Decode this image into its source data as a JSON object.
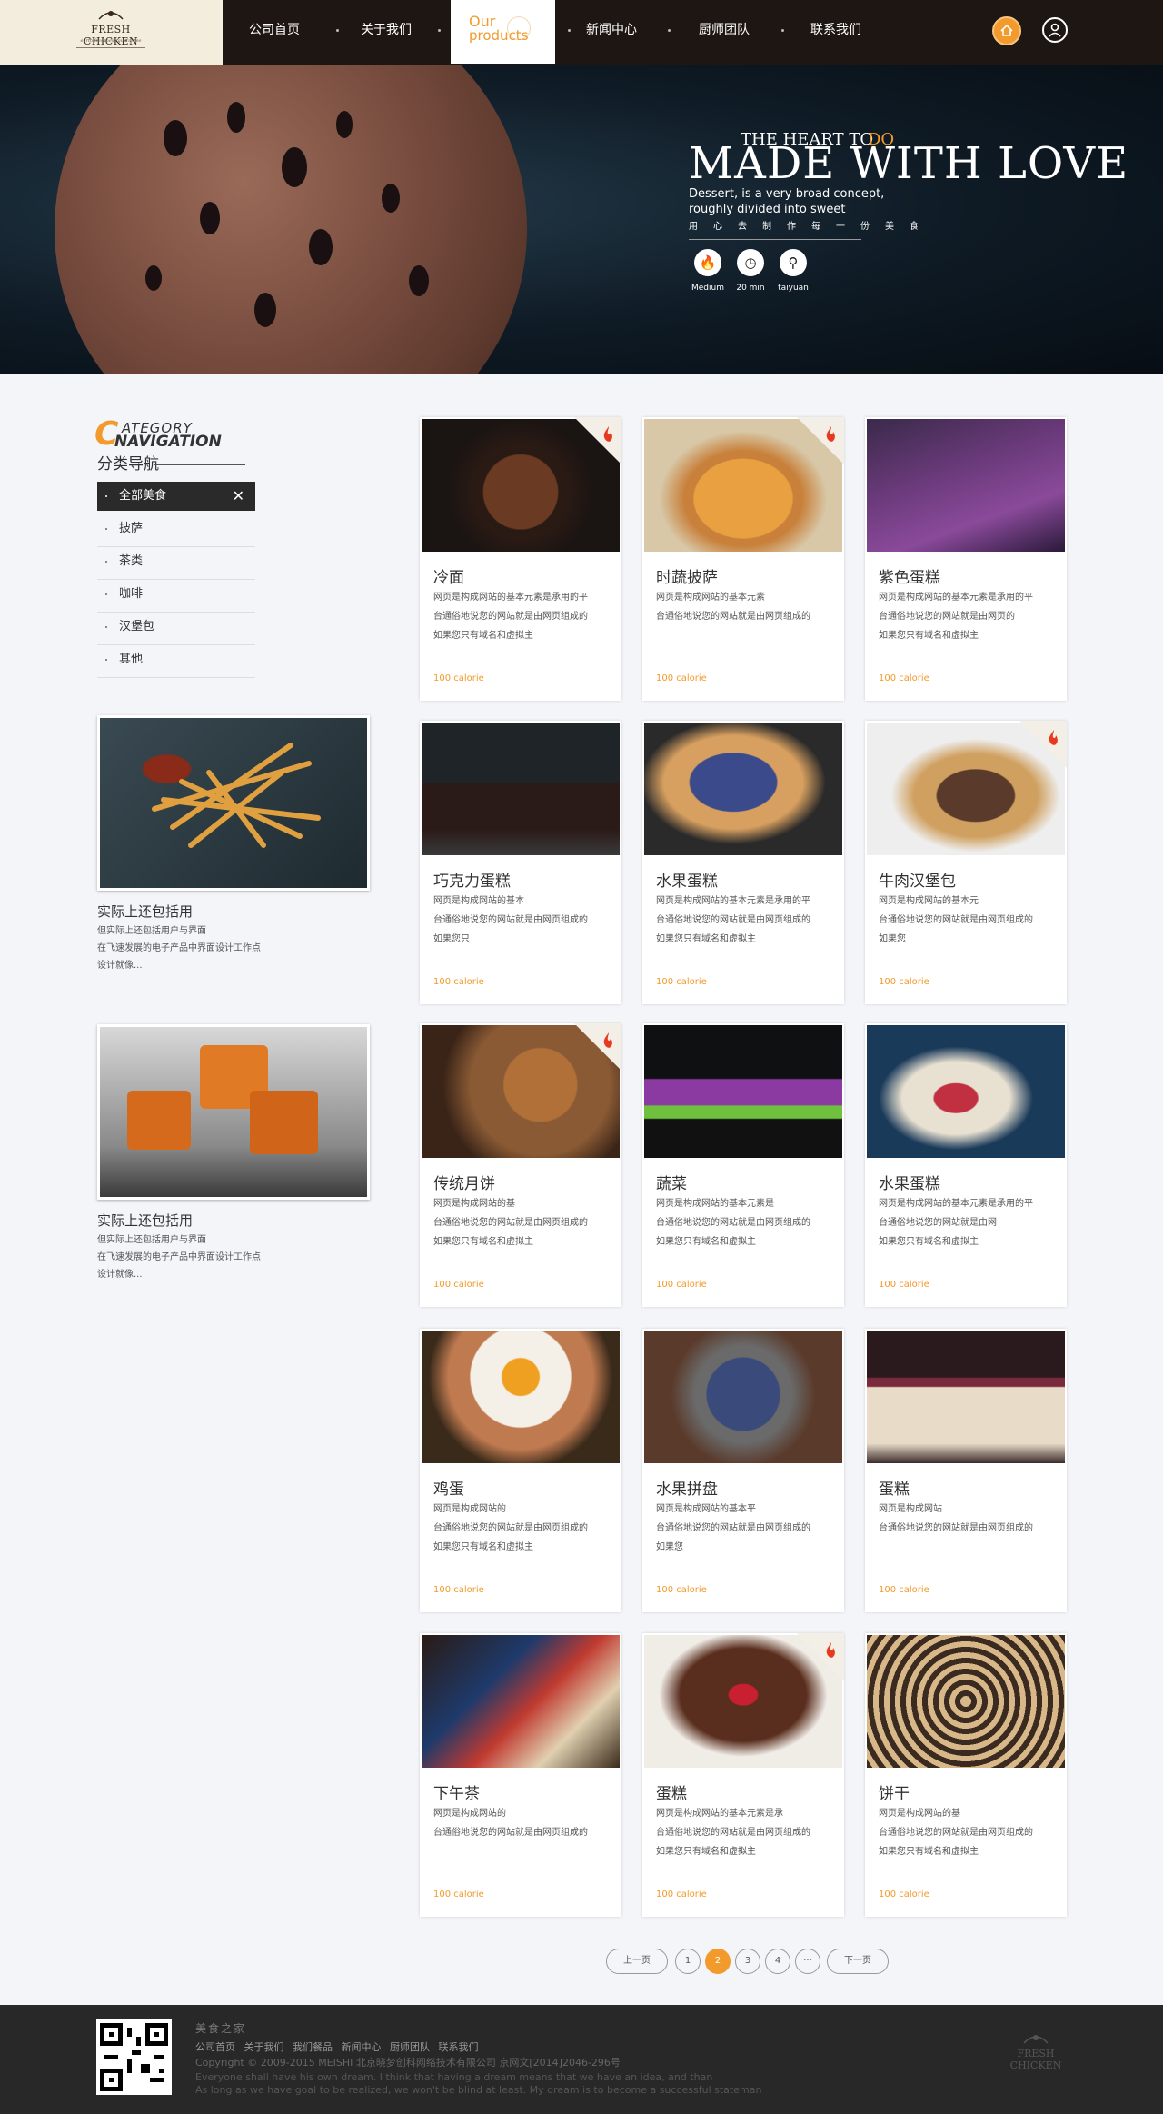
{
  "header": {
    "logo_text": "FRESH CHICKEN",
    "logo_sub": "earth freshness guarantee",
    "nav": [
      {
        "label": "公司首页"
      },
      {
        "label": "关于我们"
      },
      {
        "label": "Our products",
        "active": true
      },
      {
        "label": "新闻中心"
      },
      {
        "label": "厨师团队"
      },
      {
        "label": "联系我们"
      }
    ],
    "nav_active_en1": "Our",
    "nav_active_en2": "products",
    "accent_color": "#f39a2c"
  },
  "hero": {
    "title_small": "THE HEART TO",
    "title_do": "DO",
    "title_big": "MADE WITH LOVE",
    "desc": "Dessert, is a very broad concept, roughly divided into sweet",
    "cn_line": "用心去制作每一份美食",
    "icons": [
      {
        "icon": "flame-icon",
        "label": "Medium"
      },
      {
        "icon": "clock-icon",
        "label": "20 min"
      },
      {
        "icon": "location-icon",
        "label": "taiyuan"
      }
    ]
  },
  "sidebar": {
    "title_c": "C",
    "title_line1": "ATEGORY",
    "title_line2": "NAVIGATION",
    "title_cn": "分类导航",
    "categories": [
      {
        "label": "全部美食"
      },
      {
        "label": "披萨"
      },
      {
        "label": "茶类"
      },
      {
        "label": "咖啡"
      },
      {
        "label": "汉堡包"
      },
      {
        "label": "其他"
      }
    ],
    "features": [
      {
        "title": "实际上还包括用",
        "desc1": "但实际上还包括用户与界面",
        "desc2": "在飞速发展的电子产品中界面设计工作点",
        "desc3": "设计就像..."
      },
      {
        "title": "实际上还包括用",
        "desc1": "但实际上还包括用户与界面",
        "desc2": "在飞速发展的电子产品中界面设计工作点",
        "desc3": "设计就像..."
      }
    ]
  },
  "cards": [
    {
      "title": "冷面",
      "d1": "网页是构成网站的基本元素是承用的平",
      "d2": "台通俗地说您的网站就是由网页组成的",
      "d3": "如果您只有域名和虚拟主",
      "cal": "100 calorie",
      "hot": true
    },
    {
      "title": "时蔬披萨",
      "d1": "网页是构成网站的基本元素",
      "d2": "台通俗地说您的网站就是由网页组成的",
      "d3": "",
      "cal": "100 calorie",
      "hot": true
    },
    {
      "title": "紫色蛋糕",
      "d1": "网页是构成网站的基本元素是承用的平",
      "d2": "台通俗地说您的网站就是由网页的",
      "d3": "如果您只有域名和虚拟主",
      "cal": "100 calorie",
      "hot": false
    },
    {
      "title": "巧克力蛋糕",
      "d1": "网页是构成网站的基本",
      "d2": "台通俗地说您的网站就是由网页组成的",
      "d3": "如果您只",
      "cal": "100 calorie",
      "hot": false
    },
    {
      "title": "水果蛋糕",
      "d1": "网页是构成网站的基本元素是承用的平",
      "d2": "台通俗地说您的网站就是由网页组成的",
      "d3": "如果您只有域名和虚拟主",
      "cal": "100 calorie",
      "hot": false
    },
    {
      "title": "牛肉汉堡包",
      "d1": "网页是构成网站的基本元",
      "d2": "台通俗地说您的网站就是由网页组成的",
      "d3": "如果您",
      "cal": "100 calorie",
      "hot": true
    },
    {
      "title": "传统月饼",
      "d1": "网页是构成网站的基",
      "d2": "台通俗地说您的网站就是由网页组成的",
      "d3": "如果您只有域名和虚拟主",
      "cal": "100 calorie",
      "hot": true
    },
    {
      "title": "蔬菜",
      "d1": "网页是构成网站的基本元素是",
      "d2": "台通俗地说您的网站就是由网页组成的",
      "d3": "如果您只有域名和虚拟主",
      "cal": "100 calorie",
      "hot": false
    },
    {
      "title": "水果蛋糕",
      "d1": "网页是构成网站的基本元素是承用的平",
      "d2": "台通俗地说您的网站就是由网",
      "d3": "如果您只有域名和虚拟主",
      "cal": "100 calorie",
      "hot": false
    },
    {
      "title": "鸡蛋",
      "d1": "网页是构成网站的",
      "d2": "台通俗地说您的网站就是由网页组成的",
      "d3": "如果您只有域名和虚拟主",
      "cal": "100 calorie",
      "hot": false
    },
    {
      "title": "水果拼盘",
      "d1": "网页是构成网站的基本平",
      "d2": "台通俗地说您的网站就是由网页组成的",
      "d3": "如果您",
      "cal": "100 calorie",
      "hot": false
    },
    {
      "title": "蛋糕",
      "d1": "网页是构成网站",
      "d2": "台通俗地说您的网站就是由网页组成的",
      "d3": "",
      "cal": "100 calorie",
      "hot": false
    },
    {
      "title": "下午茶",
      "d1": "网页是构成网站的",
      "d2": "台通俗地说您的网站就是由网页组成的",
      "d3": "",
      "cal": "100 calorie",
      "hot": false
    },
    {
      "title": "蛋糕",
      "d1": "网页是构成网站的基本元素是承",
      "d2": "台通俗地说您的网站就是由网页组成的",
      "d3": "如果您只有域名和虚拟主",
      "cal": "100 calorie",
      "hot": true
    },
    {
      "title": "饼干",
      "d1": "网页是构成网站的基",
      "d2": "台通俗地说您的网站就是由网页组成的",
      "d3": "如果您只有域名和虚拟主",
      "cal": "100 calorie",
      "hot": false
    }
  ],
  "pagination": {
    "prev": "上一页",
    "pages": [
      "1",
      "2",
      "3",
      "4",
      "···"
    ],
    "current": "2",
    "next": "下一页"
  },
  "footer": {
    "brand": "美食之家",
    "links": [
      "公司首页",
      "关于我们",
      "我们餐品",
      "新闻中心",
      "厨师团队",
      "联系我们"
    ],
    "copyright": "Copyright © 2009-2015 MEISHI 北京晓梦创科网络技术有限公司    京网文[2014]2046-296号",
    "quote1": "Everyone shall have his own dream. I think that having a dream means that we have an idea, and than",
    "quote2": "As long as we have goal to be realized, we won't be blind at least. My dream is to become a successful stateman",
    "logo_text": "FRESH CHICKEN"
  }
}
